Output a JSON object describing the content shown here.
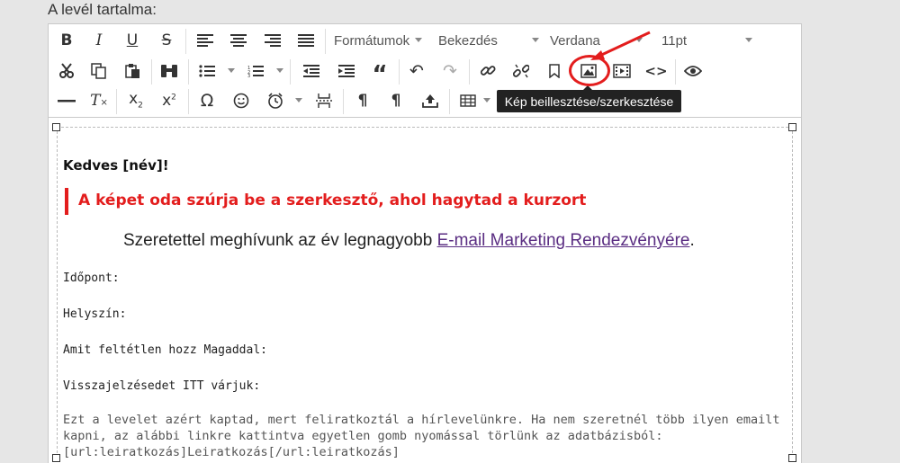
{
  "section_label": "A levél tartalma:",
  "toolbar": {
    "dropdowns": {
      "formats": "Formátumok",
      "block": "Bekezdés",
      "font": "Verdana",
      "size": "11pt"
    },
    "tooltip": "Kép beillesztése/szerkesztése",
    "highlight_color": "#e31d1d"
  },
  "content": {
    "greeting": "Kedves [név]!",
    "note": "A képet oda szúrja be a szerkesztő, ahol hagytad a kurzort",
    "invite_text": "Szeretettel meghívunk az év legnagyobb ",
    "invite_link": "E-mail Marketing Rendezvényére",
    "invite_end": ".",
    "fields": [
      "Időpont:",
      "Helyszín:",
      "Amit feltétlen hozz Magaddal:",
      "Visszajelzésedet ITT várjuk:"
    ],
    "footer": "Ezt a levelet azért kaptad, mert feliratkoztál a hírlevelünkre. Ha nem szeretnél több ilyen emailt kapni, az alábbi linkre kattintva egyetlen gomb nyomással törlünk az adatbázisból: [url:leiratkozás]Leiratkozás[/url:leiratkozás]"
  }
}
